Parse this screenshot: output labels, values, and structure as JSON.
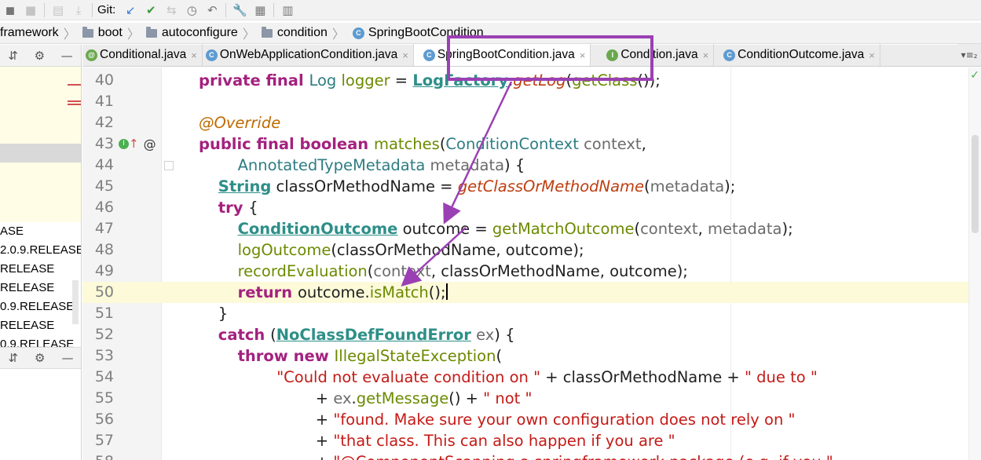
{
  "toolbar": {
    "git_label": "Git:"
  },
  "breadcrumb": [
    {
      "label": "framework",
      "icon": "none"
    },
    {
      "label": "boot",
      "icon": "folder-icon"
    },
    {
      "label": "autoconfigure",
      "icon": "folder-icon"
    },
    {
      "label": "condition",
      "icon": "folder-icon"
    },
    {
      "label": "SpringBootCondition",
      "icon": "class-icon"
    }
  ],
  "left_panel": {
    "items": [
      "ASE",
      "2.0.9.RELEASE",
      "RELEASE",
      "RELEASE",
      "0.9.RELEASE",
      "RELEASE",
      "0.9.RELEASE"
    ]
  },
  "tabs": [
    {
      "label": "Conditional.java",
      "icon": "@",
      "type": "at"
    },
    {
      "label": "OnWebApplicationCondition.java",
      "icon": "C",
      "type": "c"
    },
    {
      "label": "SpringBootCondition.java",
      "icon": "C",
      "type": "c",
      "active": true
    },
    {
      "label": "Condition.java",
      "icon": "I",
      "type": "i"
    },
    {
      "label": "ConditionOutcome.java",
      "icon": "C",
      "type": "c"
    }
  ],
  "tab_close": "×",
  "tab_more": "▾≡₂",
  "colors": {
    "highlight": "#9b40b4",
    "keyword": "#a4217f",
    "string": "#c41a16",
    "method": "#6b8a00",
    "type": "#2e7d83"
  },
  "editor": {
    "current_line": 50,
    "lines": [
      {
        "n": "40",
        "tokens": [
          {
            "c": "kw",
            "t": "private final "
          },
          {
            "c": "ty",
            "t": "Log "
          },
          {
            "c": "fn",
            "t": "logger"
          },
          {
            "c": "pl",
            "t": " = "
          },
          {
            "c": "tyb",
            "t": "LogFactory"
          },
          {
            "c": "pl",
            "t": "."
          },
          {
            "c": "it",
            "t": "getLog"
          },
          {
            "c": "pl",
            "t": "("
          },
          {
            "c": "fn",
            "t": "getClass"
          },
          {
            "c": "pl",
            "t": "());"
          }
        ]
      },
      {
        "n": "41",
        "tokens": []
      },
      {
        "n": "42",
        "tokens": [
          {
            "c": "an",
            "t": "@Override"
          }
        ]
      },
      {
        "n": "43",
        "tokens": [
          {
            "c": "kw",
            "t": "public final boolean "
          },
          {
            "c": "fn",
            "t": "matches"
          },
          {
            "c": "pl",
            "t": "("
          },
          {
            "c": "ty",
            "t": "ConditionContext "
          },
          {
            "c": "pa",
            "t": "context"
          },
          {
            "c": "pl",
            "t": ","
          }
        ]
      },
      {
        "n": "44",
        "tokens": [
          {
            "c": "pl",
            "t": "        "
          },
          {
            "c": "ty",
            "t": "AnnotatedTypeMetadata "
          },
          {
            "c": "pa",
            "t": "metadata"
          },
          {
            "c": "pl",
            "t": ") {"
          }
        ]
      },
      {
        "n": "45",
        "tokens": [
          {
            "c": "pl",
            "t": "    "
          },
          {
            "c": "tyb",
            "t": "String"
          },
          {
            "c": "pl",
            "t": " classOrMethodName = "
          },
          {
            "c": "it",
            "t": "getClassOrMethodName"
          },
          {
            "c": "pl",
            "t": "("
          },
          {
            "c": "pa",
            "t": "metadata"
          },
          {
            "c": "pl",
            "t": ");"
          }
        ]
      },
      {
        "n": "46",
        "tokens": [
          {
            "c": "pl",
            "t": "    "
          },
          {
            "c": "kw",
            "t": "try "
          },
          {
            "c": "pl",
            "t": "{"
          }
        ]
      },
      {
        "n": "47",
        "tokens": [
          {
            "c": "pl",
            "t": "        "
          },
          {
            "c": "tyb",
            "t": "ConditionOutcome"
          },
          {
            "c": "pl",
            "t": " outcome = "
          },
          {
            "c": "fn",
            "t": "getMatchOutcome"
          },
          {
            "c": "pl",
            "t": "("
          },
          {
            "c": "pa",
            "t": "context"
          },
          {
            "c": "pl",
            "t": ", "
          },
          {
            "c": "pa",
            "t": "metadata"
          },
          {
            "c": "pl",
            "t": ");"
          }
        ]
      },
      {
        "n": "48",
        "tokens": [
          {
            "c": "pl",
            "t": "        "
          },
          {
            "c": "fn",
            "t": "logOutcome"
          },
          {
            "c": "pl",
            "t": "(classOrMethodName, outcome);"
          }
        ]
      },
      {
        "n": "49",
        "tokens": [
          {
            "c": "pl",
            "t": "        "
          },
          {
            "c": "fn",
            "t": "recordEvaluation"
          },
          {
            "c": "pl",
            "t": "("
          },
          {
            "c": "pa",
            "t": "context"
          },
          {
            "c": "pl",
            "t": ", classOrMethodName, outcome);"
          }
        ]
      },
      {
        "n": "50",
        "tokens": [
          {
            "c": "pl",
            "t": "        "
          },
          {
            "c": "kw",
            "t": "return "
          },
          {
            "c": "pl",
            "t": "outcome."
          },
          {
            "c": "fn",
            "t": "isMatch"
          },
          {
            "c": "pl",
            "t": "();"
          }
        ]
      },
      {
        "n": "51",
        "tokens": [
          {
            "c": "pl",
            "t": "    }"
          }
        ]
      },
      {
        "n": "52",
        "tokens": [
          {
            "c": "pl",
            "t": "    "
          },
          {
            "c": "kw",
            "t": "catch "
          },
          {
            "c": "pl",
            "t": "("
          },
          {
            "c": "tyb",
            "t": "NoClassDefFoundError"
          },
          {
            "c": "pl",
            "t": " "
          },
          {
            "c": "pa",
            "t": "ex"
          },
          {
            "c": "pl",
            "t": ") {"
          }
        ]
      },
      {
        "n": "53",
        "tokens": [
          {
            "c": "pl",
            "t": "        "
          },
          {
            "c": "kw",
            "t": "throw new "
          },
          {
            "c": "fn",
            "t": "IllegalStateException"
          },
          {
            "c": "pl",
            "t": "("
          }
        ]
      },
      {
        "n": "54",
        "tokens": [
          {
            "c": "pl",
            "t": "                "
          },
          {
            "c": "st",
            "t": "\"Could not evaluate condition on \""
          },
          {
            "c": "pl",
            "t": " + classOrMethodName + "
          },
          {
            "c": "st",
            "t": "\" due to \""
          }
        ]
      },
      {
        "n": "55",
        "tokens": [
          {
            "c": "pl",
            "t": "                        + "
          },
          {
            "c": "pa",
            "t": "ex"
          },
          {
            "c": "pl",
            "t": "."
          },
          {
            "c": "fn",
            "t": "getMessage"
          },
          {
            "c": "pl",
            "t": "() + "
          },
          {
            "c": "st",
            "t": "\" not \""
          }
        ]
      },
      {
        "n": "56",
        "tokens": [
          {
            "c": "pl",
            "t": "                        + "
          },
          {
            "c": "st",
            "t": "\"found. Make sure your own configuration does not rely on \""
          }
        ]
      },
      {
        "n": "57",
        "tokens": [
          {
            "c": "pl",
            "t": "                        + "
          },
          {
            "c": "st",
            "t": "\"that class. This can also happen if you are \""
          }
        ]
      },
      {
        "n": "58",
        "tokens": [
          {
            "c": "pl",
            "t": "                        + "
          },
          {
            "c": "st",
            "t": "\"@ComponentScanning a springframework package (e.g. if you \""
          }
        ]
      }
    ]
  }
}
